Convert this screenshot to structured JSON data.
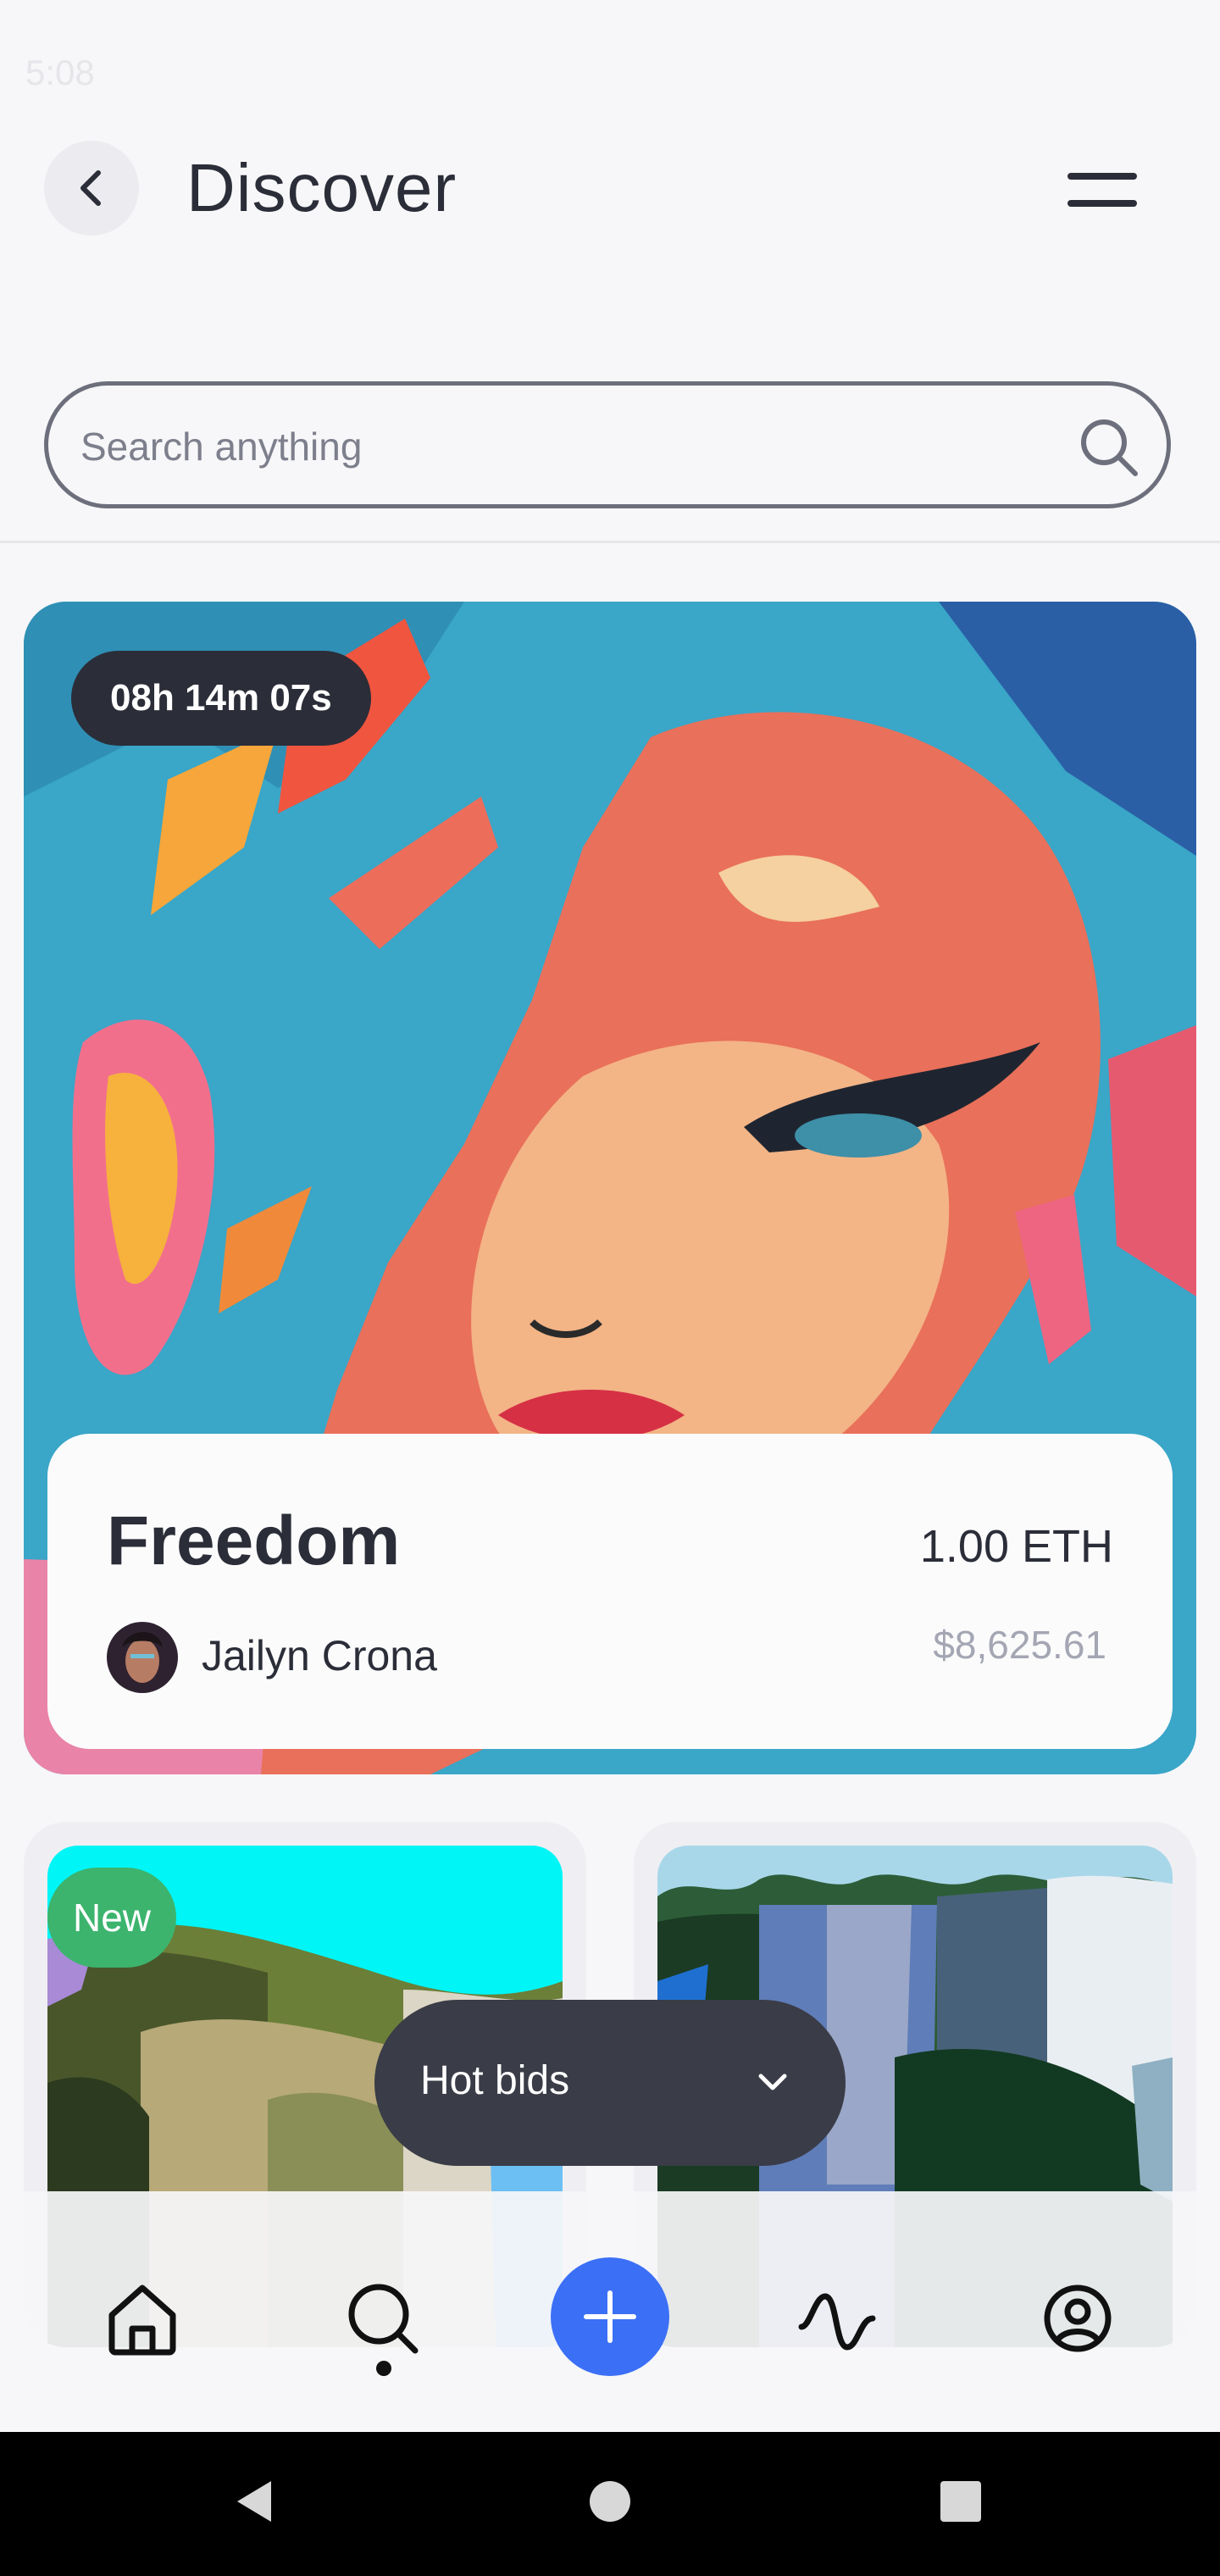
{
  "status_bar": {
    "time": "5:08"
  },
  "header": {
    "title": "Discover"
  },
  "search": {
    "placeholder": "Search anything"
  },
  "featured": {
    "timer": "08h 14m 07s",
    "title": "Freedom",
    "creator": "Jailyn Crona",
    "price_eth": "1.00 ETH",
    "price_usd": "$8,625.61"
  },
  "grid": [
    {
      "badge": "New"
    },
    {
      "badge": ""
    }
  ],
  "filter": {
    "label": "Hot bids"
  },
  "bottom_nav": {
    "items": [
      "home-icon",
      "search-icon",
      "add-icon",
      "activity-icon",
      "profile-icon"
    ],
    "active": "search-icon",
    "accent": "#3b6ff6"
  }
}
